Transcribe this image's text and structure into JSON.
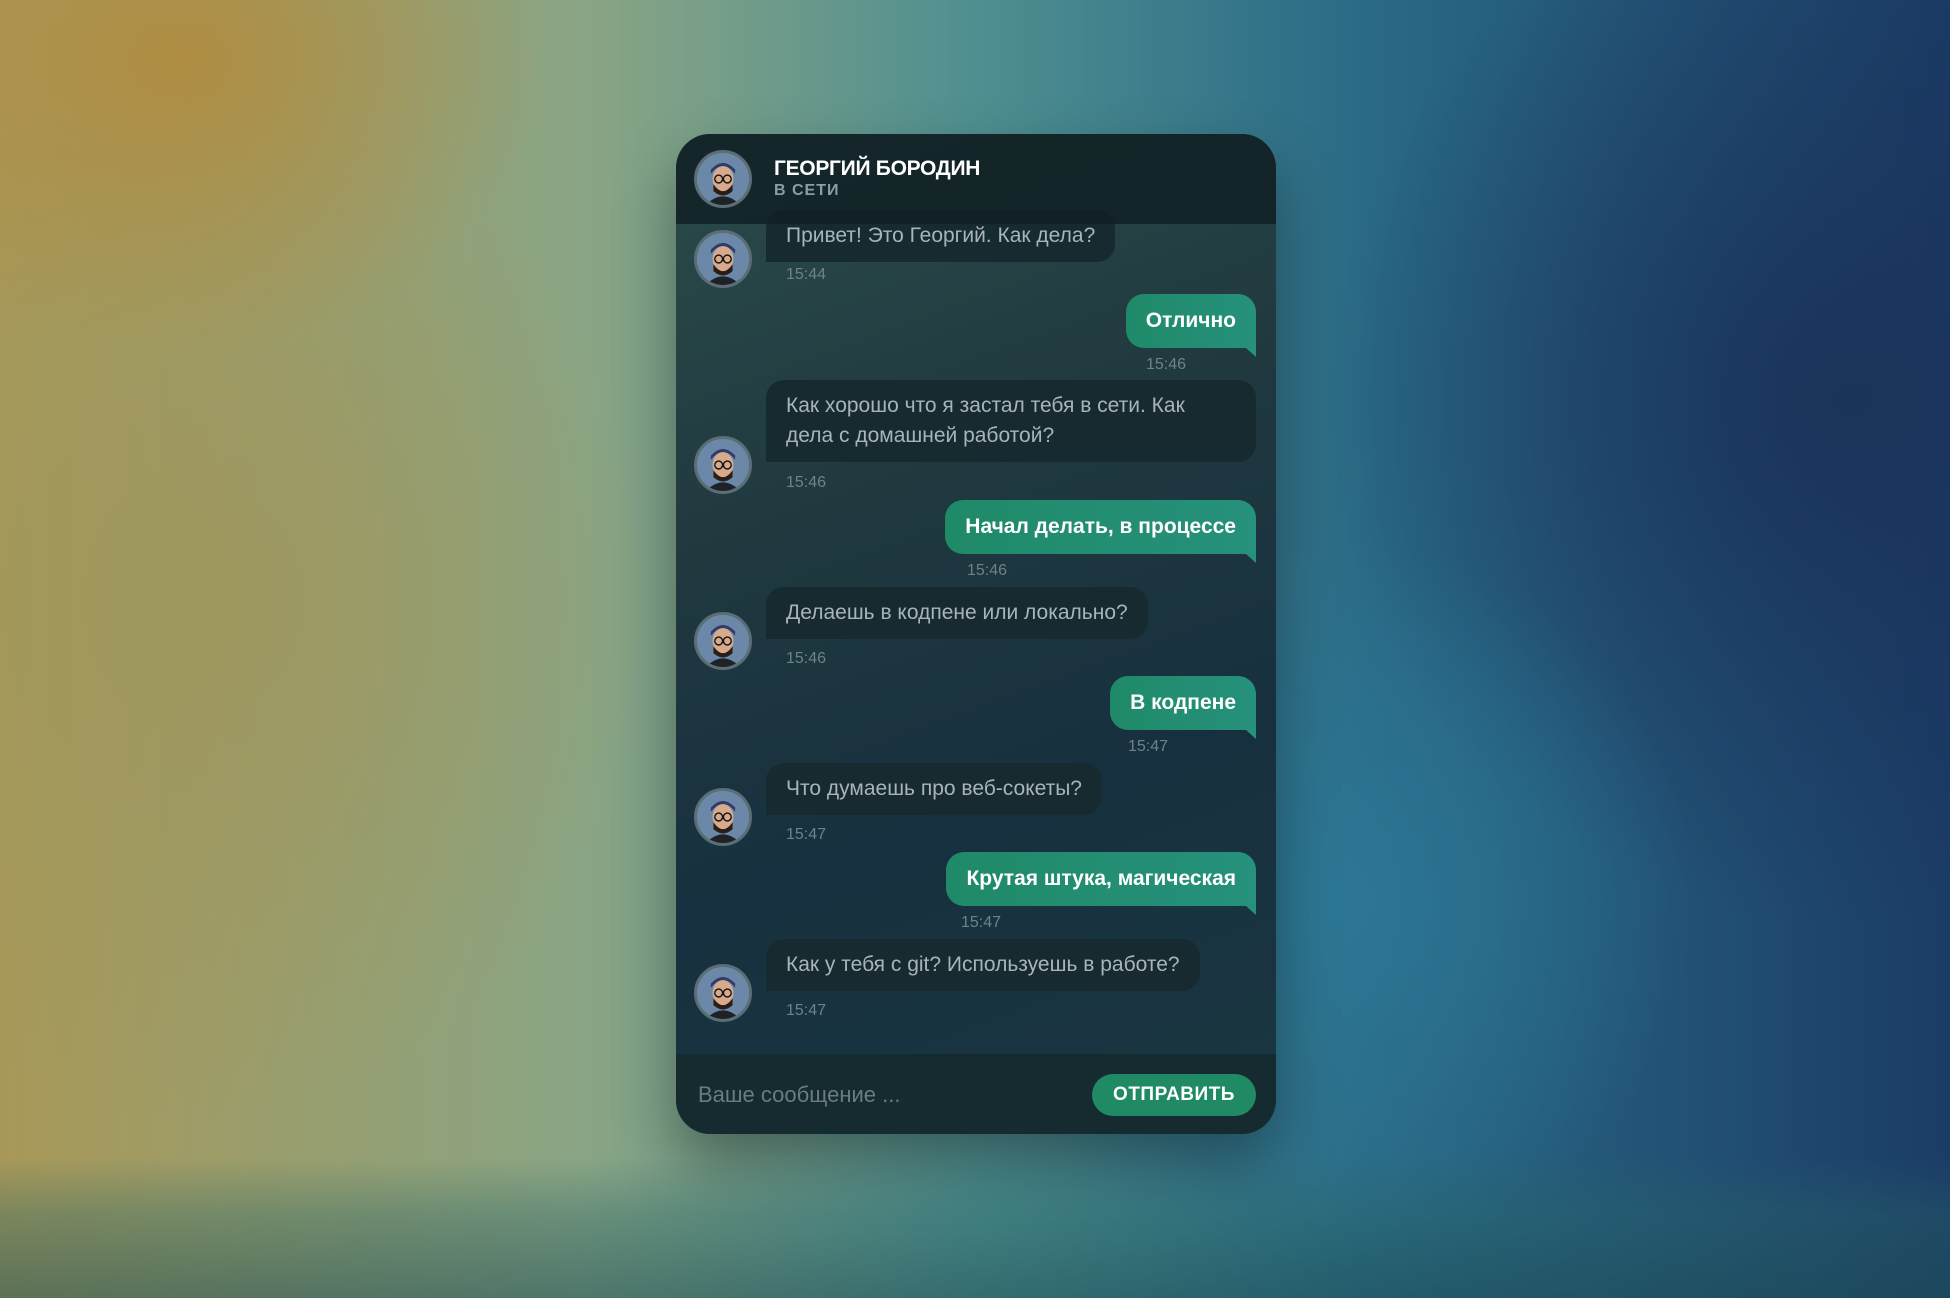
{
  "header": {
    "contact_name": "ГЕОРГИЙ БОРОДИН",
    "status": "В СЕТИ",
    "avatar_icon": "user-avatar-icon"
  },
  "messages": [
    {
      "side": "in",
      "text": "Привет! Это Георгий. Как дела?",
      "time": "15:44"
    },
    {
      "side": "out",
      "text": "Отлично",
      "time": "15:46"
    },
    {
      "side": "in",
      "text": "Как хорошо что я застал тебя в сети. Как дела с домашней работой?",
      "time": "15:46"
    },
    {
      "side": "out",
      "text": "Начал делать, в процессе",
      "time": "15:46"
    },
    {
      "side": "in",
      "text": "Делаешь в кодпене или локально?",
      "time": "15:46"
    },
    {
      "side": "out",
      "text": "В кодпене",
      "time": "15:47"
    },
    {
      "side": "in",
      "text": "Что думаешь про веб-сокеты?",
      "time": "15:47"
    },
    {
      "side": "out",
      "text": "Крутая штука, магическая",
      "time": "15:47"
    },
    {
      "side": "in",
      "text": "Как у тебя с git? Используешь в работе?",
      "time": "15:47"
    }
  ],
  "composer": {
    "placeholder": "Ваше сообщение ...",
    "value": "",
    "send_label": "ОТПРАВИТЬ"
  },
  "colors": {
    "incoming_bubble": "#162a30",
    "outgoing_bubble": "#1f8a68",
    "send_button": "#1f8a63"
  }
}
